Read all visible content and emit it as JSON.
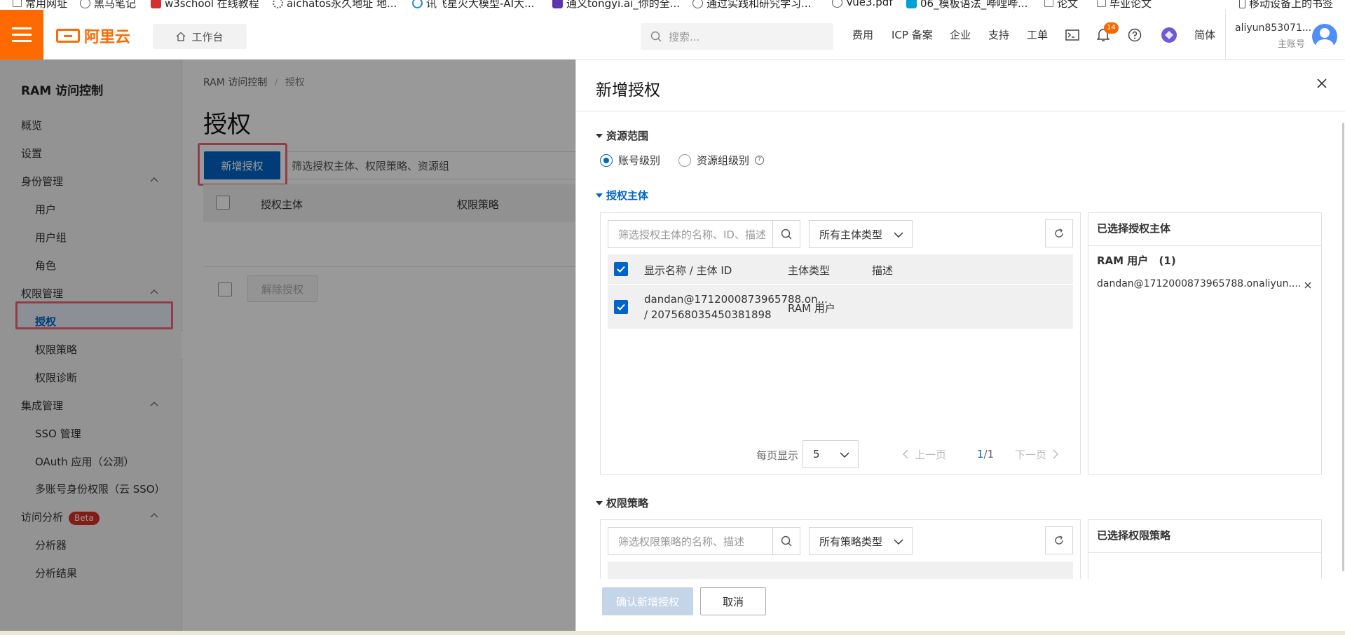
{
  "bookmarks": [
    {
      "label": "常用网址",
      "icon": "folder-icon",
      "color": "#777777"
    },
    {
      "label": "黑马笔记",
      "icon": "globe-icon",
      "color": "#555555"
    },
    {
      "label": "w3school 在线教程",
      "icon": "w3school-icon",
      "color": "#d32f2f"
    },
    {
      "label": "aichatos永久地址 地...",
      "icon": "gear-icon",
      "color": "#555555"
    },
    {
      "label": "讯飞星火大模型-AI大...",
      "icon": "spark-icon",
      "color": "#1e88e5"
    },
    {
      "label": "通义tongyi.ai_你的全...",
      "icon": "tongyi-icon",
      "color": "#5e35b1"
    },
    {
      "label": "通过实践和研究学习...",
      "icon": "globe-icon",
      "color": "#555555"
    },
    {
      "label": "Vue3.pdf",
      "icon": "globe-icon",
      "color": "#555555"
    },
    {
      "label": "06_模板语法_哔哩哔...",
      "icon": "bilibili-icon",
      "color": "#00a1d6"
    },
    {
      "label": "论文",
      "icon": "folder-icon",
      "color": "#777777"
    },
    {
      "label": "毕业论文",
      "icon": "folder-icon",
      "color": "#777777"
    },
    {
      "label": "移动设备上的书签",
      "icon": "mobile-icon",
      "color": "#555555"
    }
  ],
  "topbar": {
    "brand": "阿里云",
    "workbench": "工作台",
    "search_placeholder": "搜索...",
    "nav": [
      "费用",
      "ICP 备案",
      "企业",
      "支持",
      "工单"
    ],
    "notification_count": "14",
    "language": "简体",
    "account_name": "aliyun853071...",
    "account_type": "主账号",
    "accent": "#ff6a00"
  },
  "sidebar": {
    "title": "RAM 访问控制",
    "overview": "概览",
    "settings": "设置",
    "identity": "身份管理",
    "identity_items": [
      "用户",
      "用户组",
      "角色"
    ],
    "permission": "权限管理",
    "permission_items": [
      "授权",
      "权限策略",
      "权限诊断"
    ],
    "integration": "集成管理",
    "integration_items": [
      "SSO 管理",
      "OAuth 应用（公测）",
      "多账号身份权限（云 SSO）"
    ],
    "analysis": "访问分析",
    "analysis_badge": "Beta",
    "analysis_items": [
      "分析器",
      "分析结果"
    ]
  },
  "main": {
    "breadcrumb_root": "RAM 访问控制",
    "breadcrumb_sep": "/",
    "breadcrumb_current": "授权",
    "title": "授权",
    "add_button": "新增授权",
    "filter_placeholder": "筛选授权主体、权限策略、资源组",
    "columns": [
      "授权主体",
      "权限策略"
    ],
    "unbind_button": "解除授权",
    "primary_color": "#0064c8"
  },
  "drawer": {
    "title": "新增授权",
    "scope_title": "资源范围",
    "scope_options": [
      "账号级别",
      "资源组级别"
    ],
    "principal_title": "授权主体",
    "principal_filter_placeholder": "筛选授权主体的名称、ID、描述",
    "principal_type_select": "所有主体类型",
    "principal_columns": [
      "显示名称 / 主体 ID",
      "主体类型",
      "描述"
    ],
    "principal_rows": [
      {
        "name": "dandan@1712000873965788.on...",
        "id": "/ 207568035450381898",
        "type": "RAM 用户",
        "desc": ""
      }
    ],
    "page_size_label": "每页显示",
    "page_size": "5",
    "prev_page": "上一页",
    "page_current": "1",
    "page_total": "/1",
    "next_page": "下一页",
    "selected_principal_title": "已选择授权主体",
    "selected_group": "RAM 用户",
    "selected_count": "(1)",
    "selected_item": "dandan@1712000873965788.onaliyun....",
    "policy_title": "权限策略",
    "policy_filter_placeholder": "筛选权限策略的名称、描述",
    "policy_type_select": "所有策略类型",
    "selected_policy_title": "已选择权限策略",
    "confirm_button": "确认新增授权",
    "cancel_button": "取消"
  }
}
